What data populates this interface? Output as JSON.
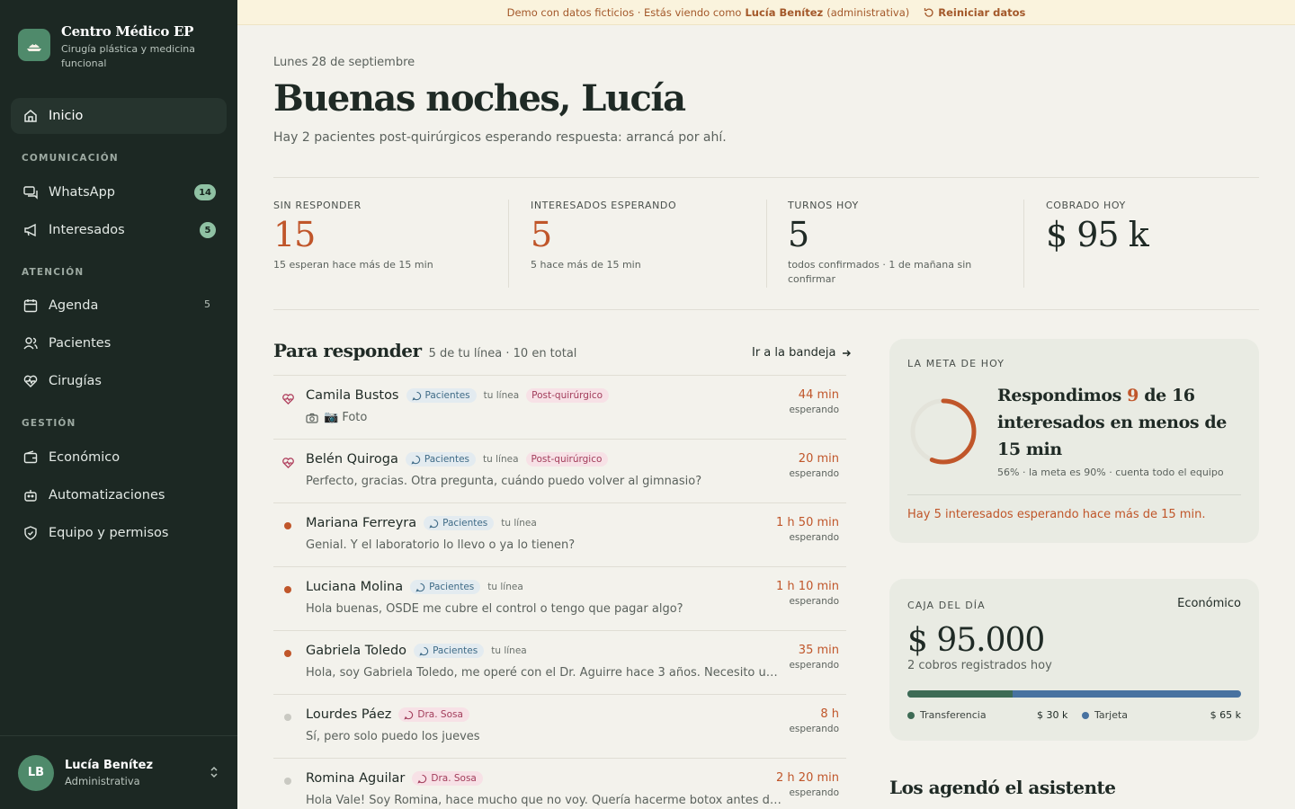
{
  "brand": {
    "name": "Centro Médico EP",
    "subtitle": "Cirugía plástica y medicina funcional"
  },
  "nav": {
    "inicio": "Inicio",
    "section_comunicacion": "COMUNICACIÓN",
    "whatsapp": "WhatsApp",
    "whatsapp_badge": "14",
    "interesados": "Interesados",
    "interesados_badge": "5",
    "section_atencion": "ATENCIÓN",
    "agenda": "Agenda",
    "agenda_count": "5",
    "pacientes": "Pacientes",
    "cirugias": "Cirugías",
    "section_gestion": "GESTIÓN",
    "economico": "Económico",
    "automatizaciones": "Automatizaciones",
    "equipo": "Equipo y permisos"
  },
  "user": {
    "initials": "LB",
    "name": "Lucía Benítez",
    "role": "Administrativa"
  },
  "banner": {
    "prefix": "Demo con datos ficticios · Estás viendo como",
    "user": "Lucía Benítez",
    "role": "(administrativa)",
    "reset": "Reiniciar datos"
  },
  "header": {
    "date": "Lunes 28 de septiembre",
    "greeting": "Buenas noches, Lucía",
    "subtitle": "Hay 2 pacientes post-quirúrgicos esperando respuesta: arrancá por ahí."
  },
  "stats": [
    {
      "label": "SIN RESPONDER",
      "value": "15",
      "note": "15 esperan hace más de 15 min"
    },
    {
      "label": "INTERESADOS ESPERANDO",
      "value": "5",
      "note": "5 hace más de 15 min"
    },
    {
      "label": "TURNOS HOY",
      "value": "5",
      "note": "todos confirmados · 1 de mañana sin confirmar"
    },
    {
      "label": "COBRADO HOY",
      "value": "$ 95 k",
      "note": ""
    }
  ],
  "inbox": {
    "title": "Para responder",
    "subtitle": "5 de tu línea · 10 en total",
    "link": "Ir a la bandeja",
    "rows": [
      {
        "name": "Camila Bustos",
        "tag": "Pacientes",
        "line": "tu línea",
        "extra": "Post-quirúrgico",
        "msg": "📷 Foto",
        "time": "44 min",
        "status": "esperando"
      },
      {
        "name": "Belén Quiroga",
        "tag": "Pacientes",
        "line": "tu línea",
        "extra": "Post-quirúrgico",
        "msg": "Perfecto, gracias. Otra pregunta, cuándo puedo volver al gimnasio?",
        "time": "20 min",
        "status": "esperando"
      },
      {
        "name": "Mariana Ferreyra",
        "tag": "Pacientes",
        "line": "tu línea",
        "extra": "",
        "msg": "Genial. Y el laboratorio lo llevo o ya lo tienen?",
        "time": "1 h 50 min",
        "status": "esperando"
      },
      {
        "name": "Luciana Molina",
        "tag": "Pacientes",
        "line": "tu línea",
        "extra": "",
        "msg": "Hola buenas, OSDE me cubre el control o tengo que pagar algo?",
        "time": "1 h 10 min",
        "status": "esperando"
      },
      {
        "name": "Gabriela Toledo",
        "tag": "Pacientes",
        "line": "tu línea",
        "extra": "",
        "msg": "Hola, soy Gabriela Toledo, me operé con el Dr. Aguirre hace 3 años. Necesito un certificado",
        "time": "35 min",
        "status": "esperando"
      },
      {
        "name": "Lourdes Páez",
        "tag": "Dra. Sosa",
        "line": "",
        "extra": "",
        "msg": "Sí, pero solo puedo los jueves",
        "time": "8 h",
        "status": "esperando"
      },
      {
        "name": "Romina Aguilar",
        "tag": "Dra. Sosa",
        "line": "",
        "extra": "",
        "msg": "Hola Vale! Soy Romina, hace mucho que no voy. Quería hacerme botox antes de fin de año",
        "time": "2 h 20 min",
        "status": "esperando"
      }
    ]
  },
  "goal": {
    "label": "LA META DE HOY",
    "pre": "Respondimos",
    "done": "9",
    "mid": "de 16 interesados en menos de 15 min",
    "progress": 0.56,
    "note": "56% · la meta es 90% · cuenta todo el equipo",
    "alert": "Hay 5 interesados esperando hace más de 15 min."
  },
  "caja": {
    "label": "CAJA DEL DÍA",
    "link": "Económico",
    "amount": "$ 95.000",
    "sub": "2 cobros registrados hoy",
    "transfer_share": 0.315,
    "transfer_label": "Transferencia",
    "transfer_value": "$ 30 k",
    "card_label": "Tarjeta",
    "card_value": "$ 65 k",
    "colors": {
      "transfer": "#3e6b55",
      "card": "#4872a0"
    }
  },
  "agendo": {
    "title": "Los agendó el asistente"
  },
  "colors": {
    "sidebar": "#1c2823",
    "accent": "#c0562a",
    "green": "#4f8a6b"
  }
}
